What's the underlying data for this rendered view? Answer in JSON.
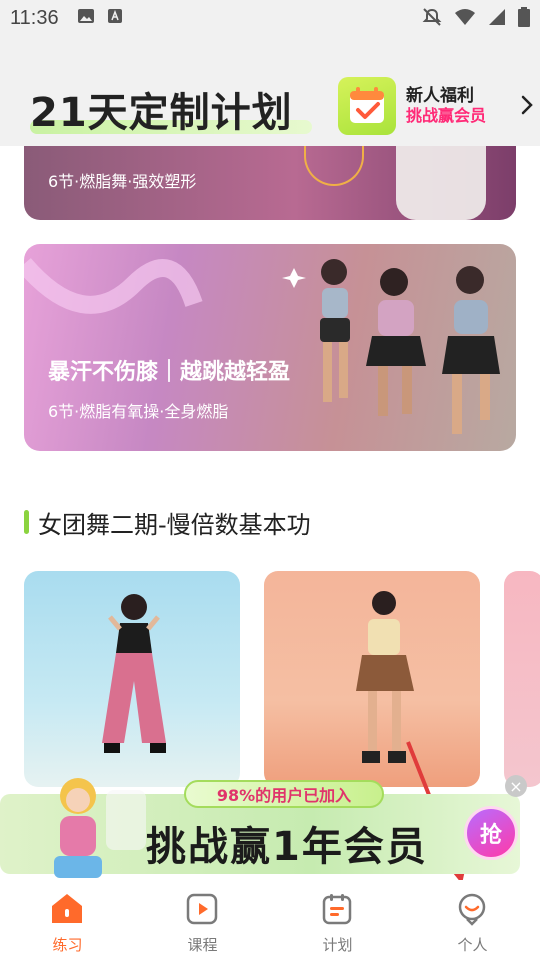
{
  "status_bar": {
    "time": "11:36"
  },
  "header": {
    "title": "21天定制计划",
    "promo": {
      "line1": "新人福利",
      "line2": "挑战赢会员"
    }
  },
  "banners": [
    {
      "subtitle": "6节·燃脂舞·强效塑形"
    },
    {
      "title": "暴汗不伤膝｜越跳越轻盈",
      "subtitle": "6节·燃脂有氧操·全身燃脂"
    }
  ],
  "section": {
    "title": "女团舞二期-慢倍数基本功"
  },
  "ad": {
    "pill_text": "98%的用户已加入",
    "title": "挑战赢1年会员",
    "button": "抢",
    "close": "×"
  },
  "bottom_nav": {
    "items": [
      {
        "label": "练习",
        "active": true
      },
      {
        "label": "课程",
        "active": false
      },
      {
        "label": "计划",
        "active": false
      },
      {
        "label": "个人",
        "active": false
      }
    ]
  },
  "colors": {
    "accent_green": "#8bd33f",
    "accent_orange": "#ff6a2b",
    "promo_pink": "#ff2a77",
    "arrow_red": "#e03b3b"
  }
}
